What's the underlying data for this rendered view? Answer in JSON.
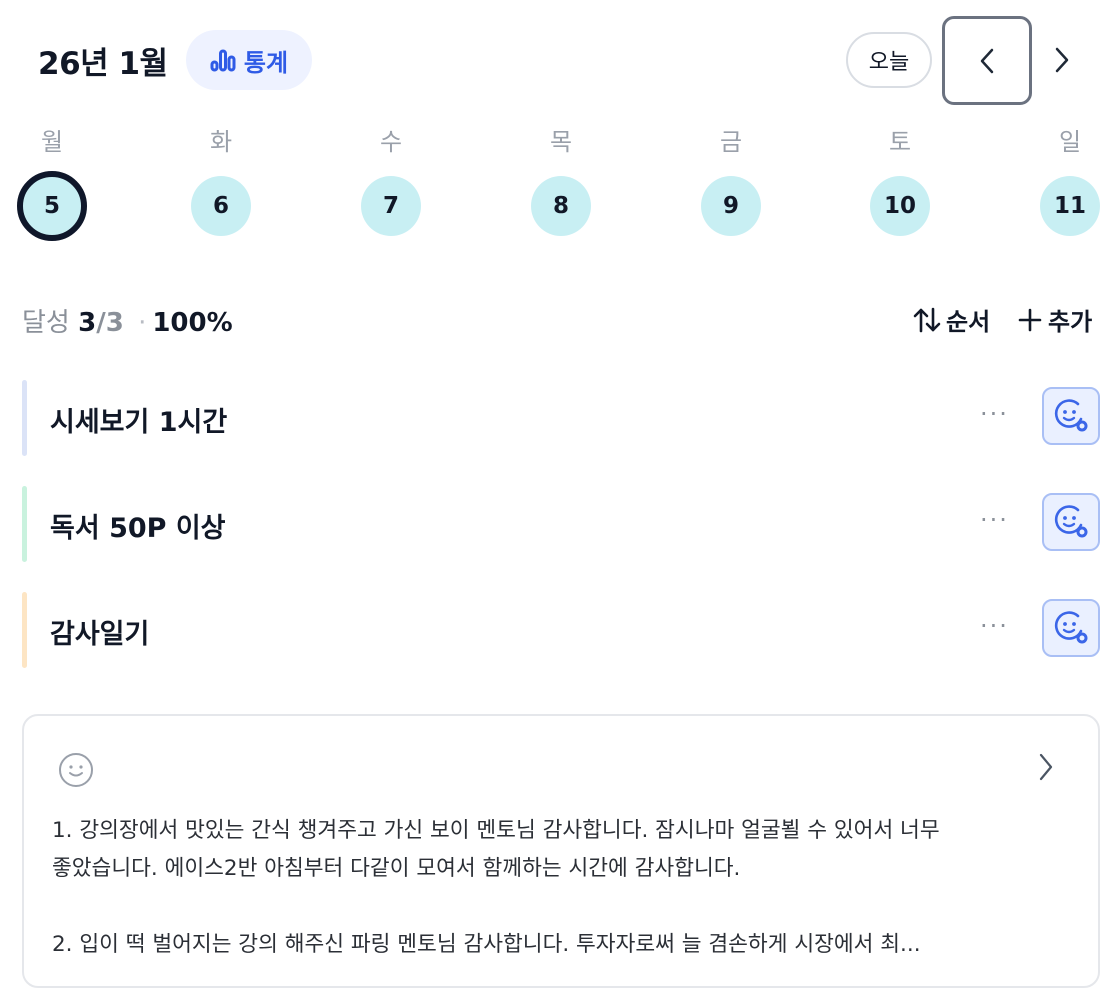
{
  "header": {
    "month_title": "26년 1월",
    "stats_label": "통계",
    "today_label": "오늘",
    "stats_icon": "bar-chart-icon",
    "prev_icon": "chevron-left-icon",
    "next_icon": "chevron-right-icon"
  },
  "week": {
    "weekdays": [
      "월",
      "화",
      "수",
      "목",
      "금",
      "토",
      "일"
    ],
    "days": [
      "5",
      "6",
      "7",
      "8",
      "9",
      "10",
      "11"
    ],
    "selected_index": 0
  },
  "progress": {
    "label": "달성",
    "done": "3",
    "total": "/3",
    "separator": "·",
    "percent": "100%"
  },
  "toolbar": {
    "order_label": "순서",
    "add_label": "추가",
    "order_icon": "sort-arrows-icon",
    "add_icon": "plus-icon"
  },
  "habits": [
    {
      "name": "시세보기 1시간",
      "color": "#dbe3f7",
      "more": "···"
    },
    {
      "name": "독서 50P 이상",
      "color": "#c9f2de",
      "more": "···"
    },
    {
      "name": "감사일기",
      "color": "#fde5c4",
      "more": "···"
    }
  ],
  "journal": {
    "icon": "smile-icon",
    "lines": [
      "1. 강의장에서 맛있는 간식 챙겨주고 가신 보이 멘토님 감사합니다. 잠시나마 얼굴뵐 수 있어서 너무",
      "좋았습니다. 에이스2반 아침부터 다같이 모여서 함께하는 시간에 감사합니다.",
      "",
      "2. 입이 떡 벌어지는 강의 해주신 파링 멘토님 감사합니다. 투자자로써 늘 겸손하게 시장에서 최..."
    ]
  },
  "colors": {
    "accent": "#2f5be6",
    "day_circle": "#c8eff3",
    "selected_ring": "#0f172a"
  }
}
